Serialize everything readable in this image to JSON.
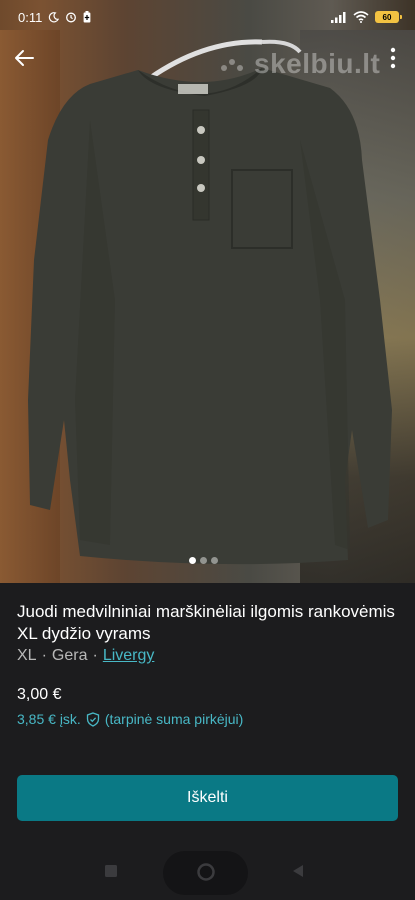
{
  "status_bar": {
    "time": "0:11",
    "battery_level": "60",
    "icons": [
      "moon-icon",
      "alarm-icon",
      "battery-saver-icon",
      "signal-icon",
      "wifi-icon",
      "battery-icon"
    ]
  },
  "hero": {
    "watermark": "skelbiu.lt",
    "image_count": 3,
    "active_image_index": 0
  },
  "listing": {
    "title": "Juodi medvilniniai marškinėliai ilgomis rankovėmis XL dydžio vyrams",
    "size": "XL",
    "separator": "·",
    "condition": "Gera",
    "brand": "Livergy",
    "price": "3,00 €",
    "price_incl_amount": "3,85 € įsk.",
    "price_incl_note": "(tarpinė suma pirkėjui)"
  },
  "actions": {
    "promote_label": "Iškelti"
  },
  "colors": {
    "accent": "#48b8c6",
    "button": "#0a7985",
    "background": "#1c1c1e"
  }
}
